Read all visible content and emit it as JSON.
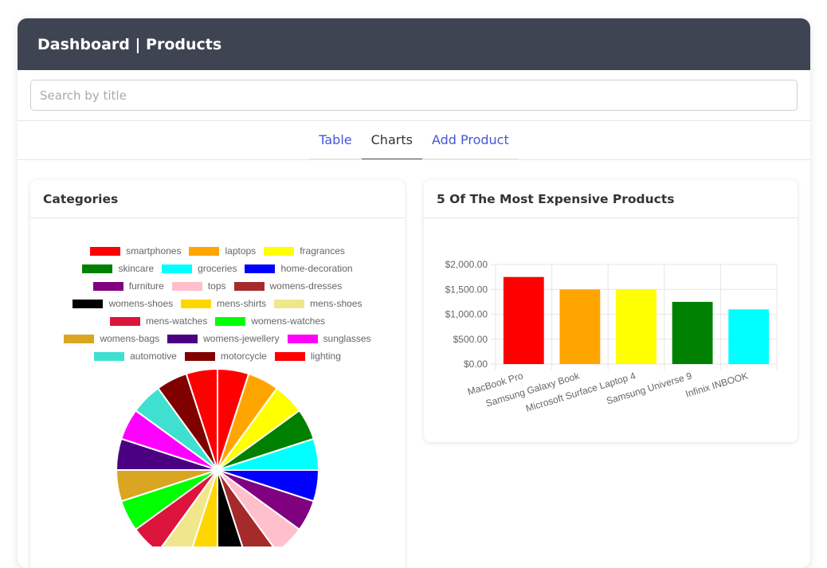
{
  "header": {
    "title": "Dashboard | Products"
  },
  "search": {
    "placeholder": "Search by title",
    "value": ""
  },
  "tabs": [
    {
      "label": "Table",
      "active": false
    },
    {
      "label": "Charts",
      "active": true
    },
    {
      "label": "Add Product",
      "active": false
    }
  ],
  "categories_card": {
    "title": "Categories"
  },
  "expensive_card": {
    "title": "5 Of The Most Expensive Products"
  },
  "colors": {
    "header_bg": "#3f4452",
    "tab_link": "#4457d9"
  },
  "chart_data": [
    {
      "type": "pie",
      "labels": [
        "smartphones",
        "laptops",
        "fragrances",
        "skincare",
        "groceries",
        "home-decoration",
        "furniture",
        "tops",
        "womens-dresses",
        "womens-shoes",
        "mens-shirts",
        "mens-shoes",
        "mens-watches",
        "womens-watches",
        "womens-bags",
        "womens-jewellery",
        "sunglasses",
        "automotive",
        "motorcycle",
        "lighting"
      ],
      "values": [
        5,
        5,
        5,
        5,
        5,
        5,
        5,
        5,
        5,
        5,
        5,
        5,
        5,
        5,
        5,
        5,
        5,
        5,
        5,
        5
      ],
      "colors": [
        "#ff0000",
        "#ffa500",
        "#ffff00",
        "#008000",
        "#00ffff",
        "#0000ff",
        "#800080",
        "#ffc0cb",
        "#a52a2a",
        "#000000",
        "#ffd700",
        "#f0e68c",
        "#dc143c",
        "#00ff00",
        "#daa520",
        "#4b0082",
        "#ff00ff",
        "#40e0d0",
        "#800000",
        "#ff0000"
      ],
      "legend_rows": [
        [
          0,
          1,
          2
        ],
        [
          3,
          4,
          5
        ],
        [
          6,
          7,
          8
        ],
        [
          9,
          10,
          11
        ],
        [
          12,
          13
        ],
        [
          14,
          15,
          16
        ],
        [
          17,
          18,
          19
        ]
      ],
      "legend": "top"
    },
    {
      "type": "bar",
      "categories": [
        "MacBook Pro",
        "Samsung Galaxy Book",
        "Microsoft Surface Laptop 4",
        "Samsung Universe 9",
        "Infinix INBOOK"
      ],
      "values": [
        1749,
        1499,
        1499,
        1249,
        1099
      ],
      "colors": [
        "#ff0000",
        "#ffa500",
        "#ffff00",
        "#008000",
        "#00ffff"
      ],
      "ylim": [
        0,
        2000
      ],
      "yticks": [
        0,
        500,
        1000,
        1500,
        2000
      ],
      "ytick_labels": [
        "$0.00",
        "$500.00",
        "$1,000.00",
        "$1,500.00",
        "$2,000.00"
      ],
      "grid": true
    }
  ]
}
